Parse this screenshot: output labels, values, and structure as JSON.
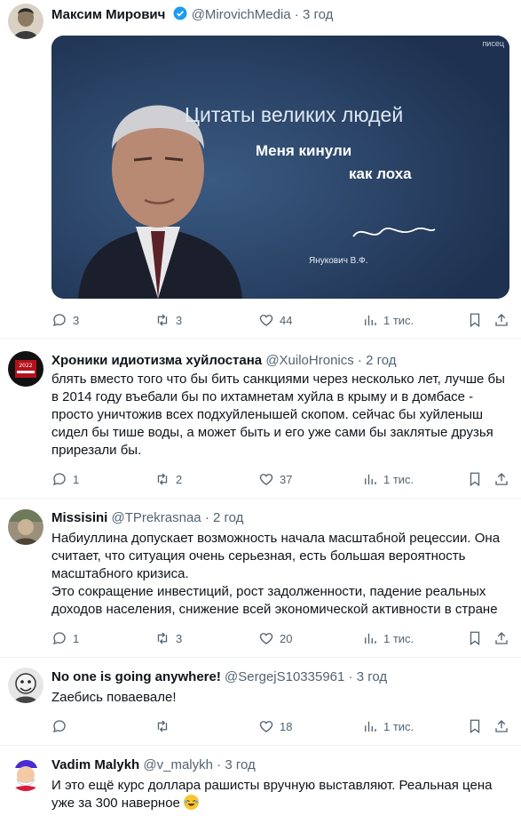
{
  "tweets": [
    {
      "name": "Максим Мирович",
      "handle": "@MirovichMedia",
      "time": "3 год",
      "text": [],
      "media": {
        "title": "Цитаты великих людей",
        "quote_line1": "Меня кинули",
        "quote_line2": "как  лоха",
        "signature": "Янукович В.Ф.",
        "watermark": "писец"
      },
      "replies": "3",
      "retweets": "3",
      "likes": "44",
      "views": "1 тис."
    },
    {
      "name": "Хроники идиотизма хуйлостана",
      "handle": "@XuiloHronics",
      "time": "2 год",
      "text": [
        "блять вместо того что бы бить санкциями через несколько лет, лучше бы в 2014 году въебали бы по ихтамнетам хуйла в крыму и в домбасе - просто уничтожив всех подхуйленышей скопом. сейчас бы хуйленыш сидел бы тише воды, а может быть и его уже сами бы заклятые друзья прирезали бы."
      ],
      "avatar_text": "2022",
      "replies": "1",
      "retweets": "2",
      "likes": "37",
      "views": "1 тис."
    },
    {
      "name": "Missisini",
      "handle": "@TPrekrasnaa",
      "time": "2 год",
      "text": [
        "Набиуллина допускает возможность начала масштабной рецессии. Она считает, что ситуация очень серьезная, есть большая вероятность масштабного кризиса.",
        "Это сокращение инвестиций, рост задолженности, падение реальных доходов населения, снижение всей экономической активности в стране"
      ],
      "replies": "1",
      "retweets": "3",
      "likes": "20",
      "views": "1 тис."
    },
    {
      "name": "No one is going anywhere!",
      "handle": "@SergejS10335961",
      "time": "3 год",
      "text": [
        "Zаебись поваевале!"
      ],
      "replies": "",
      "retweets": "",
      "likes": "18",
      "views": "1 тис."
    },
    {
      "name": "Vadim Malykh",
      "handle": "@v_malykh",
      "time": "3 год",
      "text": [
        "И это ещё курс доллара рашисты вручную выставляют. Реальная цена уже за 300 наверное"
      ]
    }
  ],
  "colors": {
    "text": "#0f1419",
    "muted": "#536471",
    "verified": "#1d9bf0",
    "divider": "#eff3f4"
  },
  "icons": [
    "reply-icon",
    "retweet-icon",
    "like-icon",
    "views-icon",
    "bookmark-icon",
    "share-icon",
    "verified-icon"
  ]
}
